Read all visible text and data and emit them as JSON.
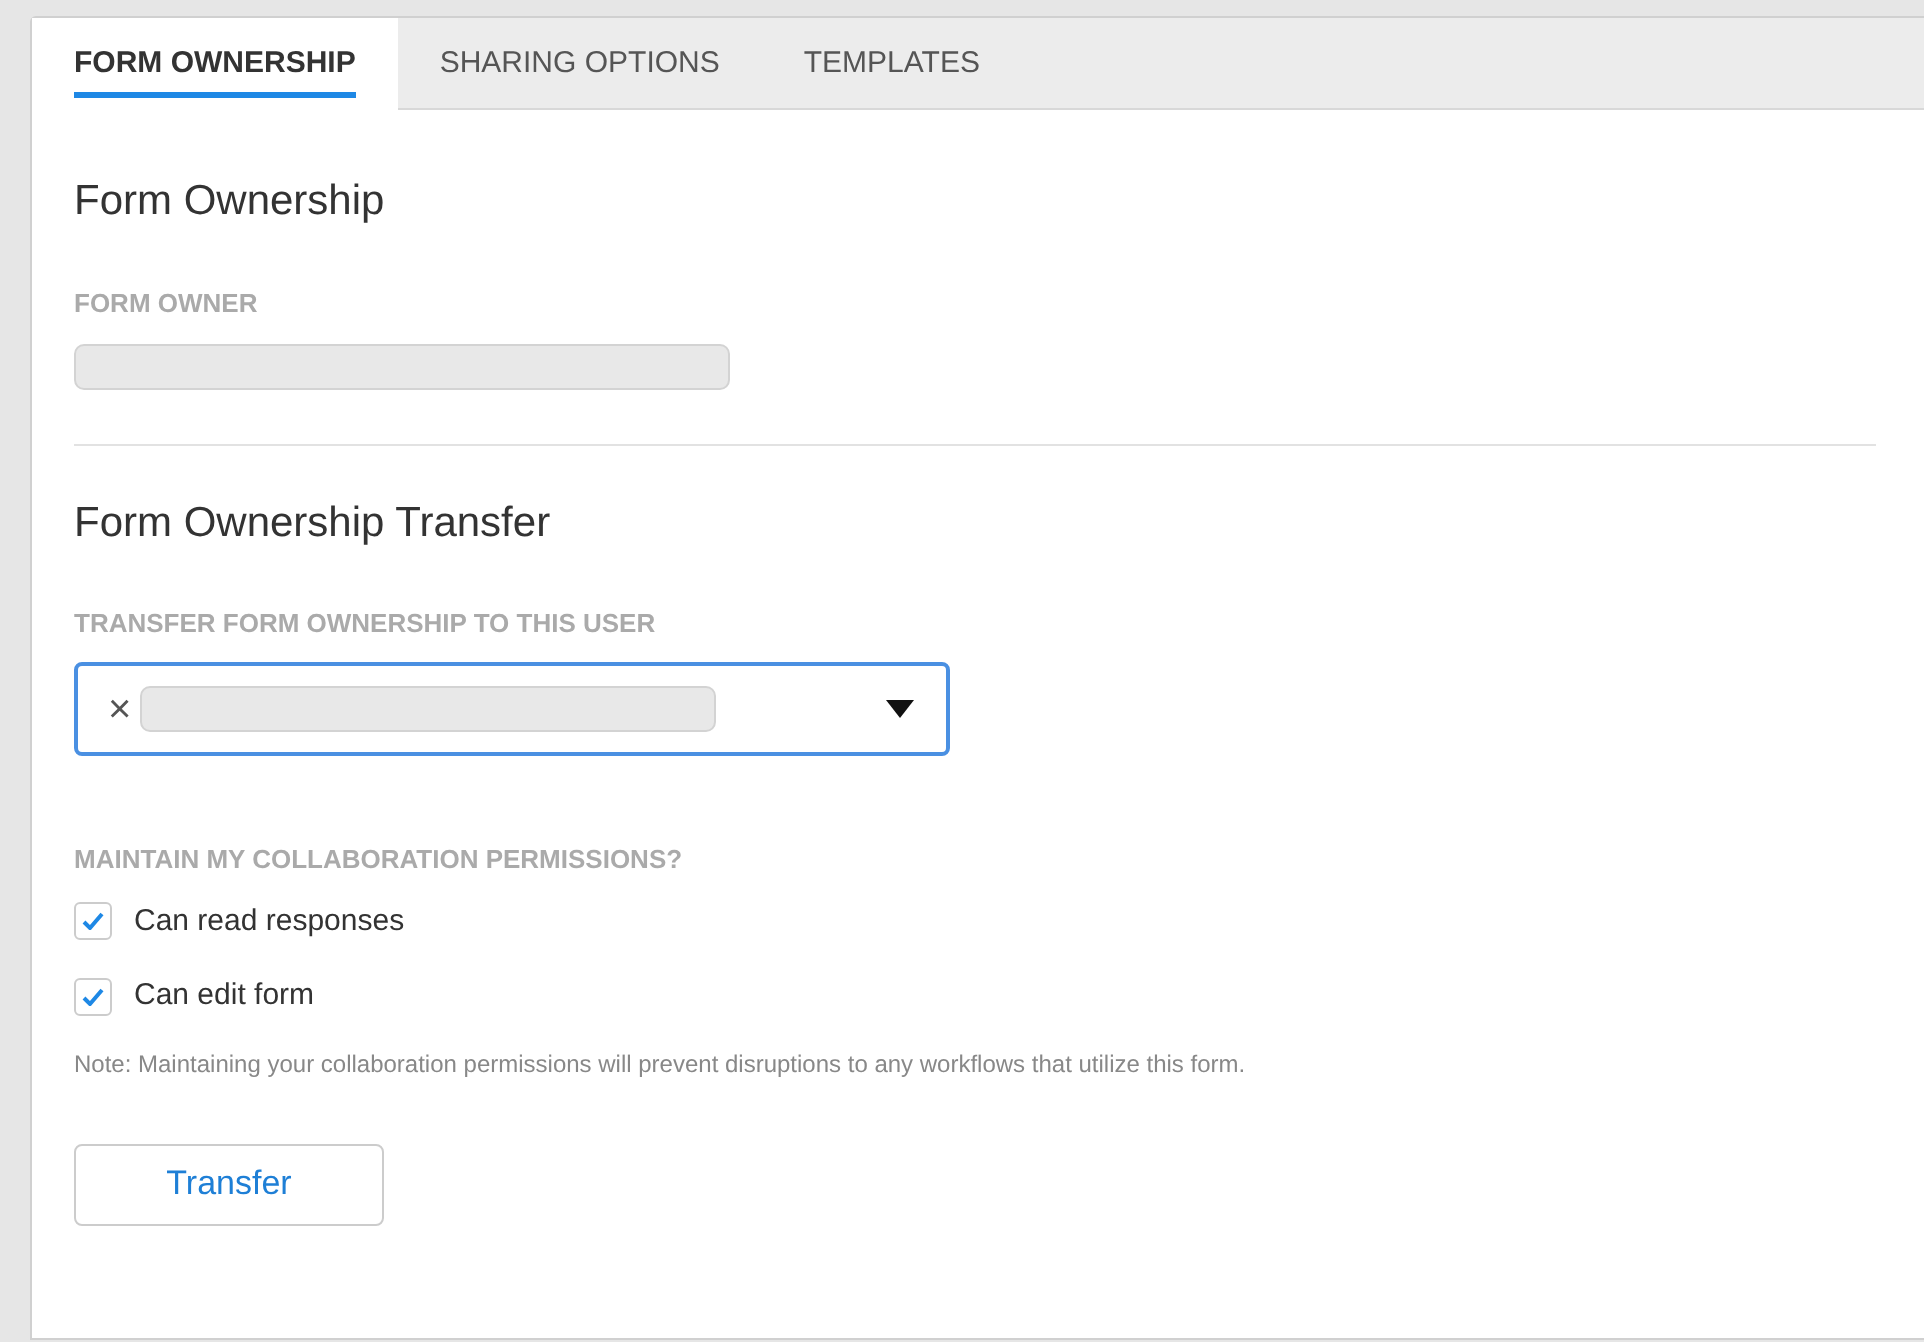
{
  "tabs": [
    {
      "label": "FORM OWNERSHIP",
      "selected": true
    },
    {
      "label": "SHARING OPTIONS",
      "selected": false
    },
    {
      "label": "TEMPLATES",
      "selected": false
    }
  ],
  "ownership": {
    "heading": "Form Ownership",
    "owner_label": "FORM OWNER"
  },
  "transfer": {
    "heading": "Form Ownership Transfer",
    "user_label": "TRANSFER FORM OWNERSHIP TO THIS USER",
    "clear_glyph": "×",
    "focused": true,
    "permissions_label": "MAINTAIN MY COLLABORATION PERMISSIONS?",
    "permissions": [
      {
        "label": "Can read responses",
        "checked": true
      },
      {
        "label": "Can edit form",
        "checked": true
      }
    ],
    "note": "Note: Maintaining your collaboration permissions will prevent disruptions to any workflows that utilize this form.",
    "button": "Transfer"
  }
}
